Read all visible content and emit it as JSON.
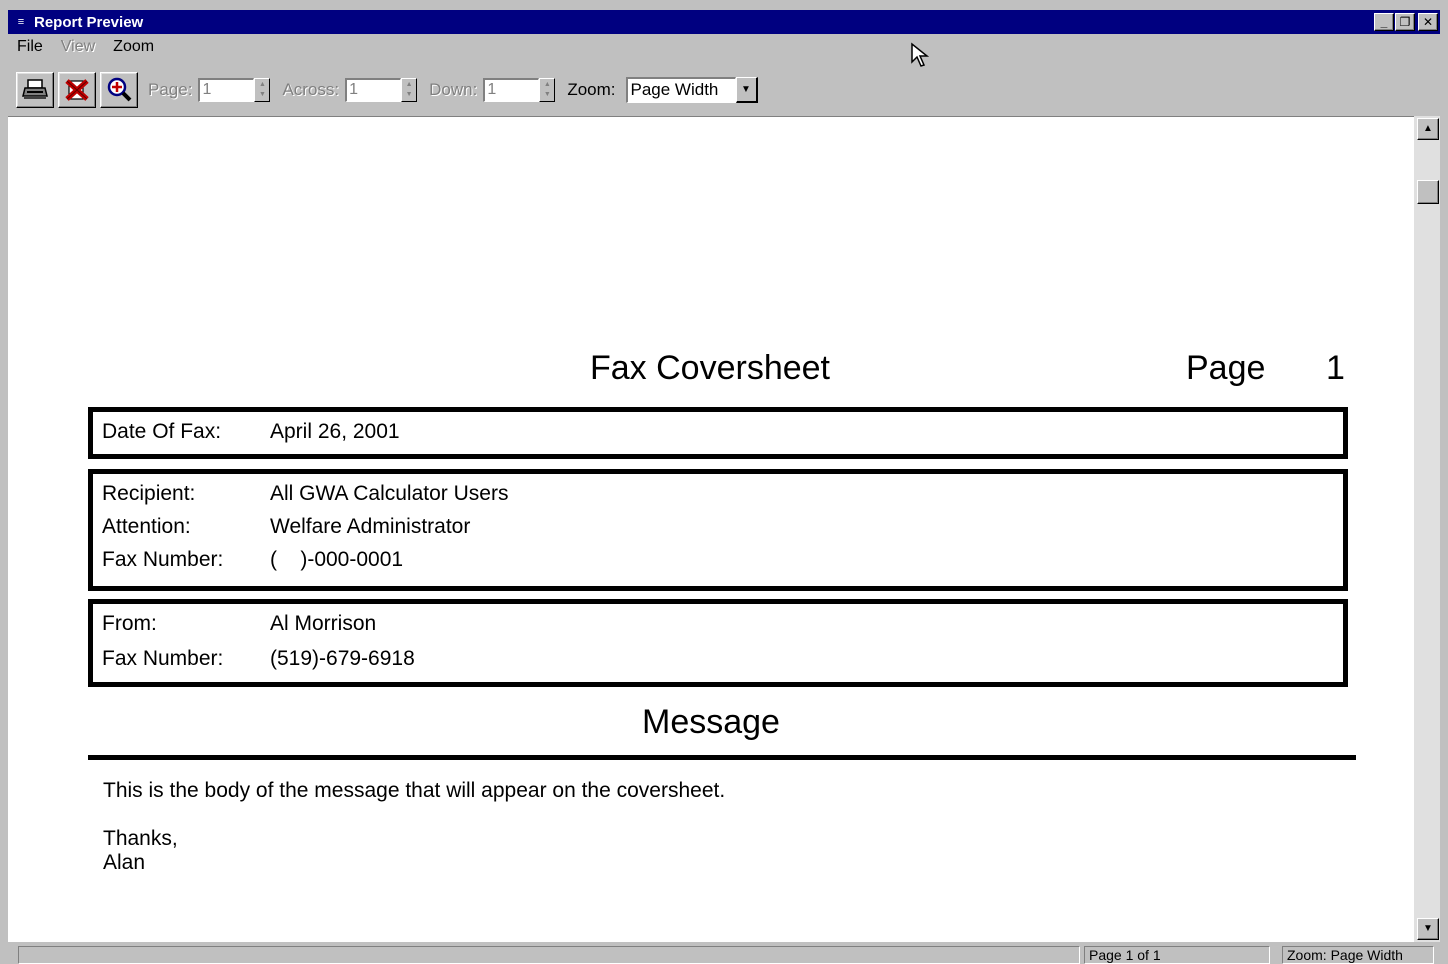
{
  "window": {
    "title": "Report Preview",
    "colors": {
      "titlebar": "#000080",
      "face": "#c0c0c0",
      "page": "#ffffff"
    }
  },
  "menu": {
    "file": "File",
    "view": "View",
    "zoom": "Zoom"
  },
  "toolbar": {
    "print_icon": "printer-icon",
    "close_icon": "close-x-icon",
    "zoom_icon": "magnifier-plus-icon",
    "page_label": "Page:",
    "page_value": "1",
    "across_label": "Across:",
    "across_value": "1",
    "down_label": "Down:",
    "down_value": "1",
    "zoom_label": "Zoom:",
    "zoom_value": "Page Width"
  },
  "report": {
    "title": "Fax Coversheet",
    "page_label": "Page",
    "page_number": "1",
    "date_label": "Date Of Fax:",
    "date_value": "April 26, 2001",
    "recipient_label": "Recipient:",
    "recipient_value": "All GWA Calculator Users",
    "attention_label": "Attention:",
    "attention_value": "Welfare Administrator",
    "fax_label": "Fax Number:",
    "recipient_fax_value": "(    )-000-0001",
    "from_label": "From:",
    "from_value": "Al Morrison",
    "sender_fax_value": "(519)-679-6918",
    "message_heading": "Message",
    "message_body": "This is the body of the message that will appear on the coversheet.",
    "closing": "Thanks,",
    "signature": "Alan"
  },
  "status": {
    "page_info": "Page 1 of 1",
    "zoom_info": "Zoom: Page Width"
  }
}
